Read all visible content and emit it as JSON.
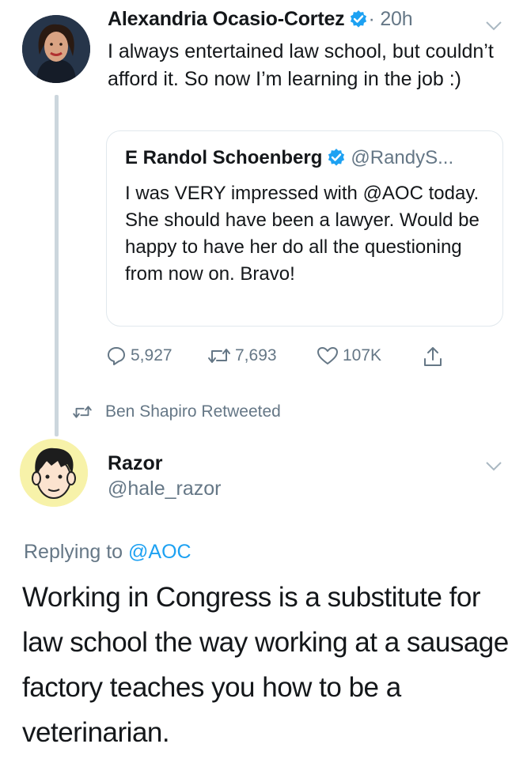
{
  "tweet1": {
    "name": "Alexandria Ocasio-Cortez",
    "time": "· 20h",
    "text": "I always entertained law school, but couldn’t afford it. So now I’m learning in the job :)"
  },
  "quote": {
    "name": "E Randol Schoenberg",
    "handle": "@RandyS...",
    "text": "I was VERY impressed with @AOC today.  She should have been a lawyer.  Would be happy to have her do all the questioning from now on. Bravo!"
  },
  "actions": {
    "replies": "5,927",
    "retweets": "7,693",
    "likes": "107K"
  },
  "retweeted_by": "Ben Shapiro Retweeted",
  "tweet2": {
    "name": "Razor",
    "handle": "@hale_razor",
    "replying_prefix": "Replying to",
    "replying_to": "@AOC",
    "text": "Working in Congress is a substitute for law school the way working at a sausage factory teaches you how to be a veterinarian."
  },
  "colors": {
    "verified_blue": "#1da1f2",
    "secondary_text": "#657786",
    "thread_line": "#ccd6dd",
    "border": "#e1e8ed"
  },
  "icons": [
    "verified-badge-icon",
    "chevron-down-icon",
    "reply-icon",
    "retweet-icon",
    "like-icon",
    "share-icon"
  ]
}
